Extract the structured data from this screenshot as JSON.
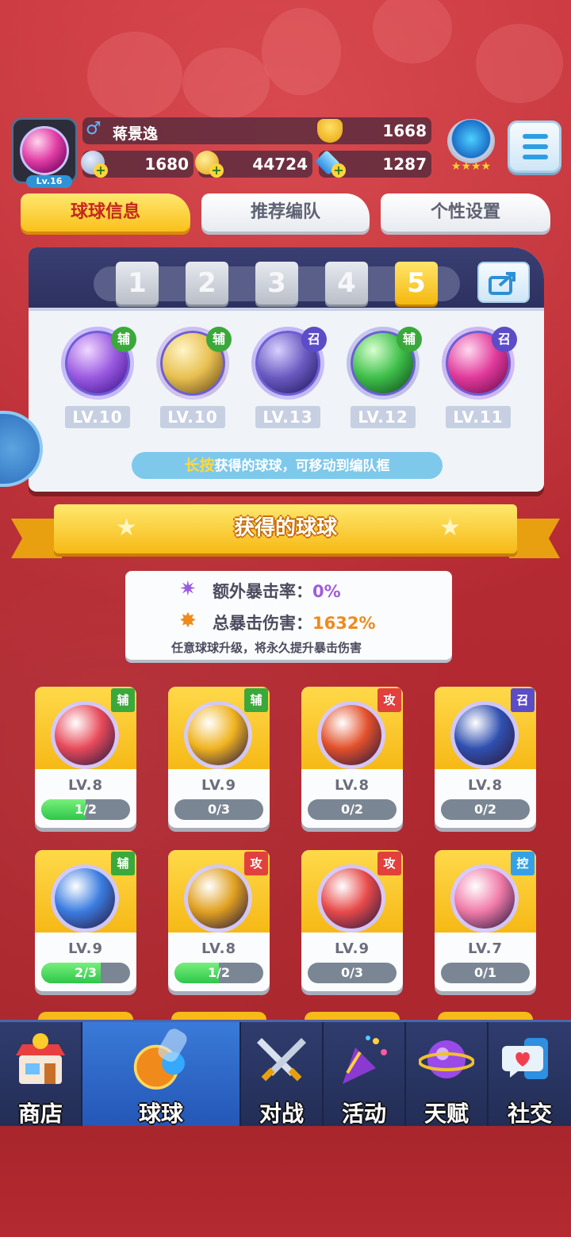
{
  "player": {
    "avatar_level": "Lv.16",
    "name": "蒋景逸",
    "gender_symbol": "♂",
    "trophies": "1668",
    "stamina": "1680",
    "coins": "44724",
    "diamonds": "1287"
  },
  "tabs": [
    {
      "label": "球球信息",
      "active": true
    },
    {
      "label": "推荐编队",
      "active": false
    },
    {
      "label": "个性设置",
      "active": false
    }
  ],
  "team": {
    "slots": [
      "1",
      "2",
      "3",
      "4",
      "5"
    ],
    "active_slot": "5",
    "balls": [
      {
        "tag": "辅",
        "level": "LV.10",
        "color": "#7a3fd0",
        "tag_color": "green"
      },
      {
        "tag": "辅",
        "level": "LV.10",
        "color": "#d8b34a",
        "tag_color": "green"
      },
      {
        "tag": "召",
        "level": "LV.13",
        "color": "#5a4aa0",
        "tag_color": "purple"
      },
      {
        "tag": "辅",
        "level": "LV.12",
        "color": "#3aa844",
        "tag_color": "green"
      },
      {
        "tag": "召",
        "level": "LV.11",
        "color": "#e03a9a",
        "tag_color": "purple"
      }
    ],
    "hint_emphasis": "长按",
    "hint_text": "获得的球球，可移动到编队框"
  },
  "section": {
    "title": "获得的球球"
  },
  "crit": {
    "extra_rate_label": "额外暴击率：",
    "extra_rate_value": "0%",
    "total_damage_label": "总暴击伤害：",
    "total_damage_value": "1632%",
    "note": "任意球球升级，将永久提升暴击伤害"
  },
  "balls": [
    {
      "tag": "辅",
      "tag_color": "green",
      "level": "LV.8",
      "progress": "1/2",
      "fill": 0.5,
      "color": "#e84a5a"
    },
    {
      "tag": "辅",
      "tag_color": "green",
      "level": "LV.9",
      "progress": "0/3",
      "fill": 0,
      "color": "#f0b320"
    },
    {
      "tag": "攻",
      "tag_color": "red",
      "level": "LV.8",
      "progress": "0/2",
      "fill": 0,
      "color": "#e2502a"
    },
    {
      "tag": "召",
      "tag_color": "purple",
      "level": "LV.8",
      "progress": "0/2",
      "fill": 0,
      "color": "#3050b0"
    },
    {
      "tag": "辅",
      "tag_color": "green",
      "level": "LV.9",
      "progress": "2/3",
      "fill": 0.667,
      "color": "#3a7ce0"
    },
    {
      "tag": "攻",
      "tag_color": "red",
      "level": "LV.8",
      "progress": "1/2",
      "fill": 0.5,
      "color": "#e0a020"
    },
    {
      "tag": "攻",
      "tag_color": "red",
      "level": "LV.9",
      "progress": "0/3",
      "fill": 0,
      "color": "#e84a4a"
    },
    {
      "tag": "控",
      "tag_color": "blue",
      "level": "LV.7",
      "progress": "0/1",
      "fill": 0,
      "color": "#f07aa8"
    }
  ],
  "nav": [
    {
      "label": "商店",
      "icon": "shop-icon",
      "active": false
    },
    {
      "label": "球球",
      "icon": "ball-icon",
      "active": true
    },
    {
      "label": "对战",
      "icon": "swords-icon",
      "active": false
    },
    {
      "label": "活动",
      "icon": "party-popper-icon",
      "active": false
    },
    {
      "label": "天赋",
      "icon": "planet-icon",
      "active": false
    },
    {
      "label": "社交",
      "icon": "chat-heart-icon",
      "active": false
    }
  ]
}
